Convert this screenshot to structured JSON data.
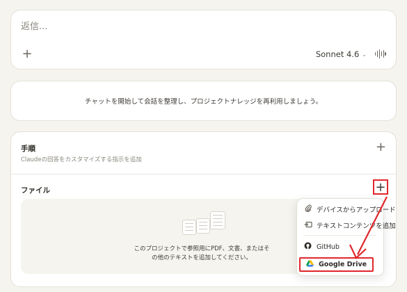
{
  "composer": {
    "placeholder": "返信...",
    "add_label": "+",
    "model_name": "Sonnet 4.6",
    "model_chevron": "⌄"
  },
  "chat_hint": {
    "text": "チャットを開始して会話を整理し、プロジェクトナレッジを再利用しましょう。"
  },
  "instructions": {
    "title": "手順",
    "description": "Claudeの回答をカスタマイズする指示を追加",
    "add_label": "+"
  },
  "files": {
    "title": "ファイル",
    "add_label": "+",
    "empty_text": "このプロジェクトで参照用にPDF、文書、またはそ\nの他のテキストを追加してください。"
  },
  "file_menu": {
    "items": [
      {
        "label": "デバイスからアップロード",
        "icon": "paperclip-icon"
      },
      {
        "label": "テキストコンテンツを追加",
        "icon": "text-content-icon"
      },
      {
        "label": "GitHub",
        "icon": "github-icon"
      },
      {
        "label": "Google Drive",
        "icon": "google-drive-icon"
      }
    ]
  },
  "colors": {
    "background": "#f5f4ef",
    "card": "#ffffff",
    "annotation": "#e0262b"
  }
}
